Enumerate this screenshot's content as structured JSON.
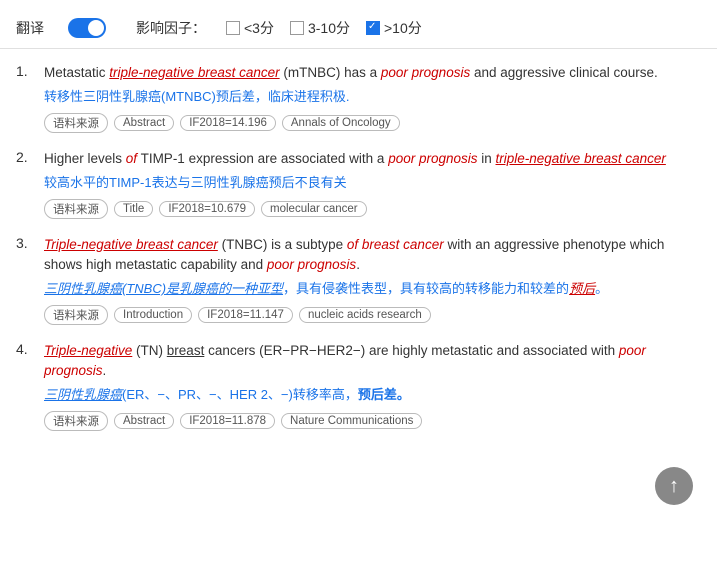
{
  "topbar": {
    "translate_label": "翻译",
    "impact_label": "影响因子：",
    "filters": [
      {
        "id": "lt3",
        "label": "<3分",
        "checked": false
      },
      {
        "id": "3to10",
        "label": "3-10分",
        "checked": false
      },
      {
        "id": "gt10",
        "label": ">10分",
        "checked": true
      }
    ]
  },
  "results": [
    {
      "index": 1,
      "en_parts": [
        {
          "text": "Metastatic ",
          "style": "normal"
        },
        {
          "text": "triple-negative breast cancer",
          "style": "italic-red-underline"
        },
        {
          "text": " (mTNBC) has a ",
          "style": "normal"
        },
        {
          "text": "poor prognosis",
          "style": "italic-red"
        },
        {
          "text": " and aggressive clinical course.",
          "style": "normal"
        }
      ],
      "zh": "转移性三阴性乳腺癌(MTNBC)预后差，临床进程积极.",
      "zh_parts": [
        {
          "text": "转移性三阴性乳腺癌(MTNBC)预后差，临床进程积极.",
          "style": "blue"
        }
      ],
      "tags": [
        "语料来源",
        "Abstract",
        "IF2018=14.196",
        "Annals of Oncology"
      ]
    },
    {
      "index": 2,
      "en_parts": [
        {
          "text": "Higher levels ",
          "style": "normal"
        },
        {
          "text": "of",
          "style": "italic-red"
        },
        {
          "text": " TIMP-1 expression are associated with a ",
          "style": "normal"
        },
        {
          "text": "poor prognosis",
          "style": "italic-red"
        },
        {
          "text": " in ",
          "style": "normal"
        },
        {
          "text": "triple-negative breast cancer",
          "style": "italic-red-underline"
        }
      ],
      "zh": "较高水平的TIMP-1表达与三阴性乳腺癌预后不良有关",
      "zh_parts": [
        {
          "text": "较高水平的TIMP-1表达与三阴性乳腺癌预后不良有关",
          "style": "blue"
        }
      ],
      "tags": [
        "语料来源",
        "Title",
        "IF2018=10.679",
        "molecular cancer"
      ]
    },
    {
      "index": 3,
      "en_parts": [
        {
          "text": "Triple-negative breast cancer",
          "style": "italic-red-underline"
        },
        {
          "text": " (TNBC) is a subtype ",
          "style": "normal"
        },
        {
          "text": "of breast cancer",
          "style": "italic-red"
        },
        {
          "text": " with an aggressive phenotype which shows high metastatic capability and ",
          "style": "normal"
        },
        {
          "text": "poor prognosis",
          "style": "italic-red"
        },
        {
          "text": ".",
          "style": "normal"
        }
      ],
      "zh": "三阴性乳腺癌(TNBC)是乳腺癌的一种亚型，具有侵袭性表型，具有较高的转移能力和较差的预后。",
      "zh_parts": [
        {
          "text": "三阴性乳腺癌(TNBC)是乳腺癌的一种亚型，具有侵袭性表型，具有较高的转移能力和较差的预后。",
          "style": "blue-italic-underline"
        }
      ],
      "tags": [
        "语料来源",
        "Introduction",
        "IF2018=11.147",
        "nucleic acids research"
      ]
    },
    {
      "index": 4,
      "en_parts": [
        {
          "text": "Triple-negative",
          "style": "italic-red-underline"
        },
        {
          "text": " (TN) ",
          "style": "normal"
        },
        {
          "text": "breast",
          "style": "underline"
        },
        {
          "text": " cancers (ER−PR−HER2−) are highly metastatic and associated with ",
          "style": "normal"
        },
        {
          "text": "poor prognosis",
          "style": "italic-red"
        },
        {
          "text": ".",
          "style": "normal"
        }
      ],
      "zh": "三阴性乳腺癌(ER、−、PR、−、HER 2、−)转移率高，预后差。",
      "zh_parts": [
        {
          "text": "三阴性乳腺癌(ER、−、PR、−、HER 2、−)转移率高，",
          "style": "blue"
        },
        {
          "text": "预后差。",
          "style": "blue-bold"
        }
      ],
      "tags": [
        "语料来源",
        "Abstract",
        "IF2018=11.878",
        "Nature Communications"
      ]
    }
  ],
  "scroll_top_label": "↑"
}
